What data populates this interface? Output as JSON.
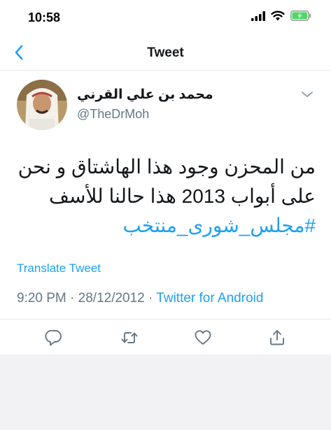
{
  "status_bar": {
    "time": "10:58"
  },
  "nav": {
    "title": "Tweet",
    "back_icon": "chevron-left-icon"
  },
  "tweet": {
    "author_name": "محمد بن علي القرني",
    "author_handle": "@TheDrMoh",
    "text_line_1": "من المحزن وجود هذا الهاشتاق و نحن",
    "text_line_2": "على أبواب 2013 هذا حالنا للأسف",
    "hashtag": "#مجلس_شورى_منتخب",
    "translate_label": "Translate Tweet",
    "time": "9:20 PM",
    "date": "28/12/2012",
    "separator": "·",
    "source": "Twitter for Android"
  },
  "actions": [
    "reply-icon",
    "retweet-icon",
    "like-icon",
    "share-icon"
  ],
  "colors": {
    "link": "#1da1f2",
    "text": "#14171a",
    "secondary": "#657786",
    "battery": "#4cd964"
  }
}
